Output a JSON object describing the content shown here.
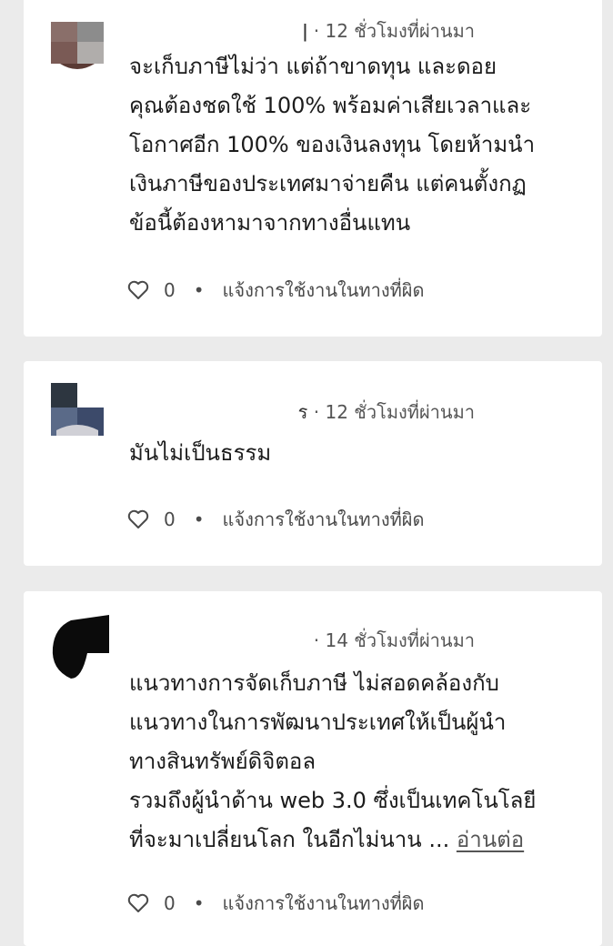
{
  "comments": [
    {
      "handle": "ǀ",
      "timestamp": "· 12 ชั่วโมงที่ผ่านมา",
      "lines": [
        "จะเก็บภาษีไม่ว่า แต่ถ้าขาดทุน และดอย",
        "คุณต้องชดใช้ 100% พร้อมค่าเสียเวลาและ",
        "โอกาศอีก 100% ของเงินลงทุน โดยห้ามนำ",
        "เงินภาษีของประเทศมาจ่ายคืน แต่คนตั้งกฏ",
        "ข้อนี้ต้องหามาจากทางอื่นแทน"
      ],
      "likes": "0",
      "report_label": "แจ้งการใช้งานในทางที่ผิด"
    },
    {
      "handle": "ร",
      "timestamp": "· 12 ชั่วโมงที่ผ่านมา",
      "lines": [
        "มันไม่เป็นธรรม"
      ],
      "likes": "0",
      "report_label": "แจ้งการใช้งานในทางที่ผิด"
    },
    {
      "handle": "",
      "timestamp": "· 14 ชั่วโมงที่ผ่านมา",
      "lines": [
        "แนวทางการจัดเก็บภาษี ไม่สอดคล้องกับ",
        "แนวทางในการพัฒนาประเทศให้เป็นผู้นำ",
        "ทางสินทรัพย์ดิจิตอล",
        "รวมถึงผู้นำด้าน web 3.0 ซึ่งเป็นเทคโนโลยี",
        "ที่จะมาเปลี่ยนโลก ในอีกไม่นาน ..."
      ],
      "read_more": "อ่านต่อ",
      "likes": "0",
      "report_label": "แจ้งการใช้งานในทางที่ผิด"
    }
  ],
  "icons": {
    "like": "heart-outline-icon"
  },
  "colors": {
    "page_background": "#ebebeb",
    "card_background": "#ffffff",
    "text": "#1c1c1c",
    "muted": "#555555"
  }
}
